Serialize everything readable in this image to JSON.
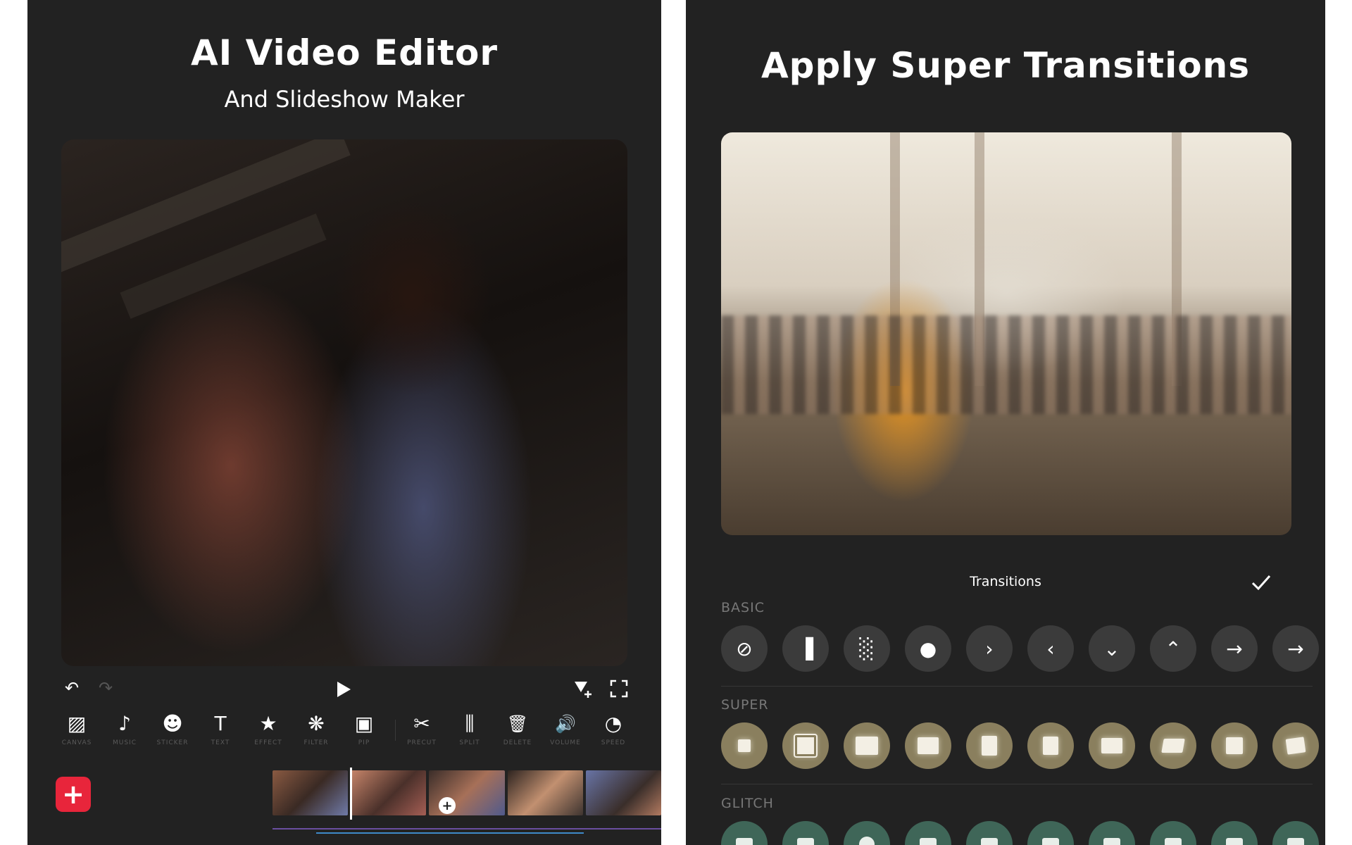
{
  "left": {
    "title": "AI Video Editor",
    "subtitle": "And Slideshow Maker",
    "toolbar": [
      {
        "label": "CANVAS",
        "icon": "canvas-icon",
        "glyph": "▨"
      },
      {
        "label": "MUSIC",
        "icon": "music-icon",
        "glyph": "♪"
      },
      {
        "label": "STICKER",
        "icon": "sticker-icon",
        "glyph": "☻"
      },
      {
        "label": "TEXT",
        "icon": "text-icon",
        "glyph": "T"
      },
      {
        "label": "EFFECT",
        "icon": "effect-icon",
        "glyph": "★"
      },
      {
        "label": "FILTER",
        "icon": "filter-icon",
        "glyph": "❋"
      },
      {
        "label": "PIP",
        "icon": "pip-icon",
        "glyph": "▣"
      },
      {
        "label": "PRECUT",
        "icon": "scissors-icon",
        "glyph": "✂"
      },
      {
        "label": "SPLIT",
        "icon": "split-icon",
        "glyph": "⫼"
      },
      {
        "label": "DELETE",
        "icon": "trash-icon",
        "glyph": "🗑"
      },
      {
        "label": "VOLUME",
        "icon": "volume-icon",
        "glyph": "🔊"
      },
      {
        "label": "SPEED",
        "icon": "speedometer-icon",
        "glyph": "◔"
      }
    ],
    "add_label": "+"
  },
  "right": {
    "title": "Apply Super Transitions",
    "panel_title": "Transitions",
    "sections": [
      {
        "label": "BASIC",
        "style": "basic",
        "items": [
          "⊘",
          "▐",
          "░",
          "●",
          "›",
          "‹",
          "⌄",
          "⌃",
          "→",
          "→"
        ]
      },
      {
        "label": "SUPER",
        "style": "super",
        "items": [
          "",
          "",
          "",
          "",
          "",
          "",
          "",
          "",
          "",
          ""
        ]
      },
      {
        "label": "GLITCH",
        "style": "glitch",
        "items": [
          "",
          "",
          "",
          "",
          "",
          "",
          "",
          "",
          "",
          ""
        ]
      }
    ]
  },
  "colors": {
    "panel_bg": "#222222",
    "accent_red": "#e8253b",
    "super_chip": "#8a7f5e",
    "glitch_chip": "#3f6658"
  }
}
